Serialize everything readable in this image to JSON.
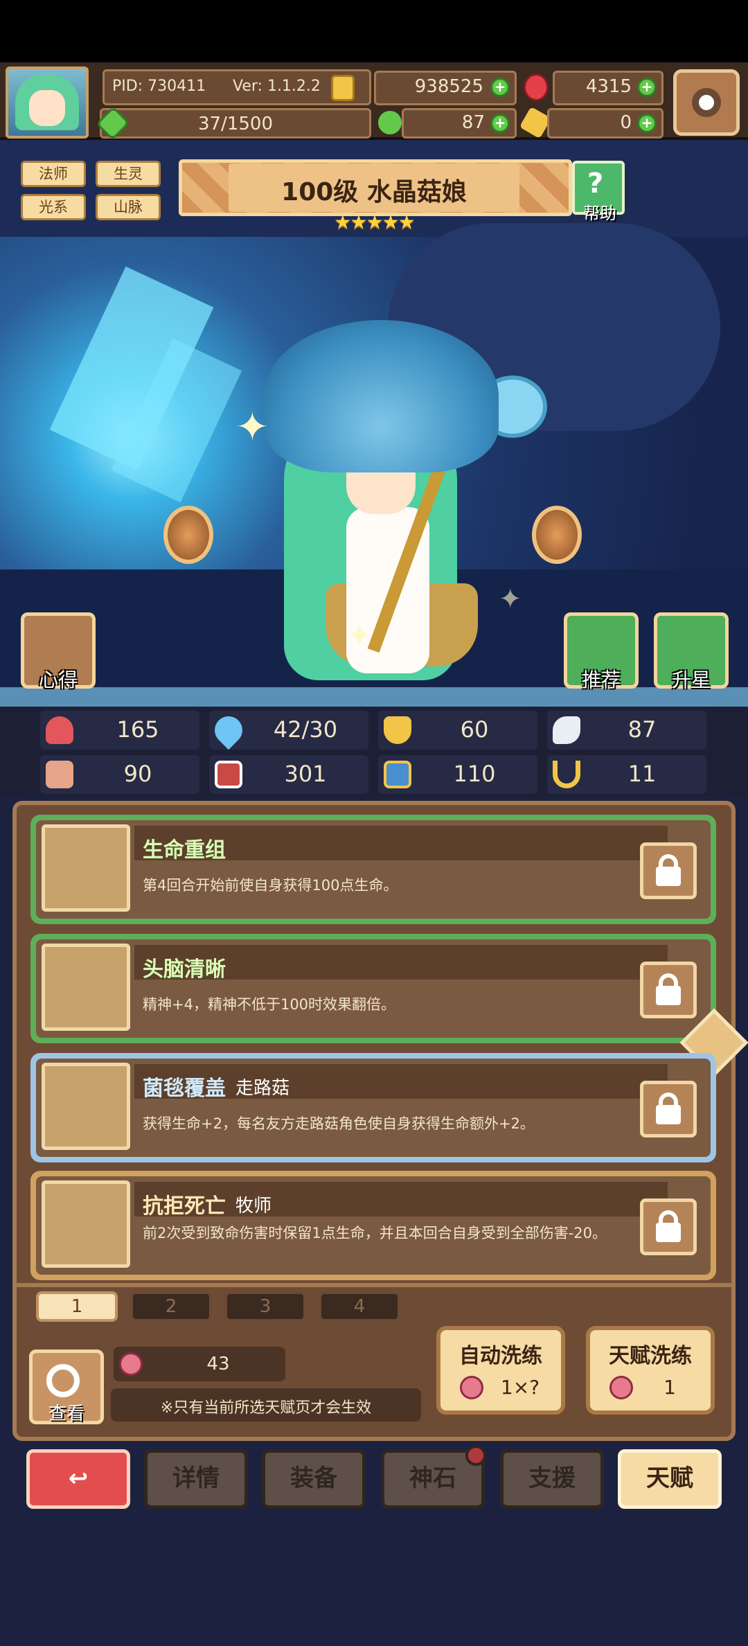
{
  "header": {
    "pid": "PID: 730411",
    "version": "Ver: 1.1.2.2",
    "gold": "938525",
    "gems": "4315",
    "exp": "37/1500",
    "clover": "87",
    "keys": "0"
  },
  "character": {
    "tags": [
      "法师",
      "生灵",
      "光系",
      "山脉"
    ],
    "title": "100级 水晶菇娘",
    "stars": "★★★★★",
    "help_label": "帮助",
    "insight_label": "心得",
    "recommend_label": "推荐",
    "upgrade_label": "升星"
  },
  "stats": {
    "hp": "165",
    "mana": "42/30",
    "armor": "60",
    "speed": "87",
    "attack": "90",
    "spirit": "301",
    "defense": "110",
    "luck": "11"
  },
  "talents": [
    {
      "name": "生命重组",
      "tag": "",
      "desc": "第4回合开始前使自身获得100点生命。",
      "border": "#5fae5a"
    },
    {
      "name": "头脑清晰",
      "tag": "",
      "desc": "精神+4，精神不低于100时效果翻倍。",
      "border": "#5fae5a"
    },
    {
      "name": "菌毯覆盖",
      "tag": "走路菇",
      "desc": "获得生命+2，每名友方走路菇角色使自身获得生命额外+2。",
      "border": "#9ec5e6"
    },
    {
      "name": "抗拒死亡",
      "tag": "牧师",
      "desc": "前2次受到致命伤害时保留1点生命，并且本回合自身受到全部伤害-20。",
      "border": "#d1a15e"
    }
  ],
  "pages": [
    "1",
    "2",
    "3",
    "4"
  ],
  "bottom": {
    "view_label": "查看",
    "resource": "43",
    "note": "※只有当前所选天赋页才会生效",
    "auto_reroll": "自动洗练",
    "auto_cost": "1×?",
    "talent_reroll": "天赋洗练",
    "talent_cost": "1"
  },
  "nav": {
    "details": "详情",
    "equipment": "装备",
    "godstone": "神石",
    "support": "支援",
    "talent": "天赋"
  }
}
